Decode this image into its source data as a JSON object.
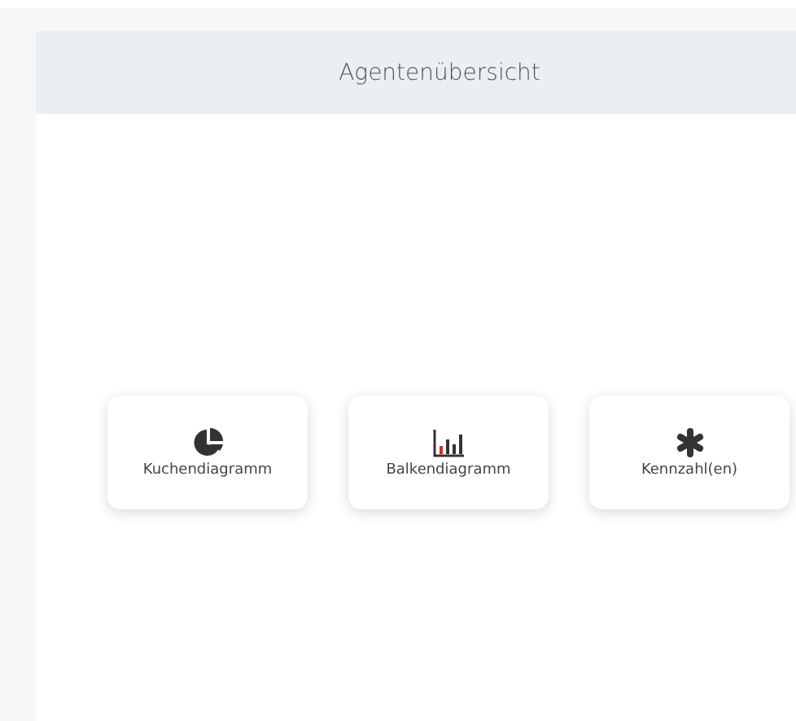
{
  "panel": {
    "title": "Agentenübersicht"
  },
  "options": [
    {
      "kind": "pie",
      "label": "Kuchendiagramm"
    },
    {
      "kind": "bar",
      "label": "Balkendiagramm"
    },
    {
      "kind": "metric",
      "label": "Kennzahl(en)"
    }
  ]
}
